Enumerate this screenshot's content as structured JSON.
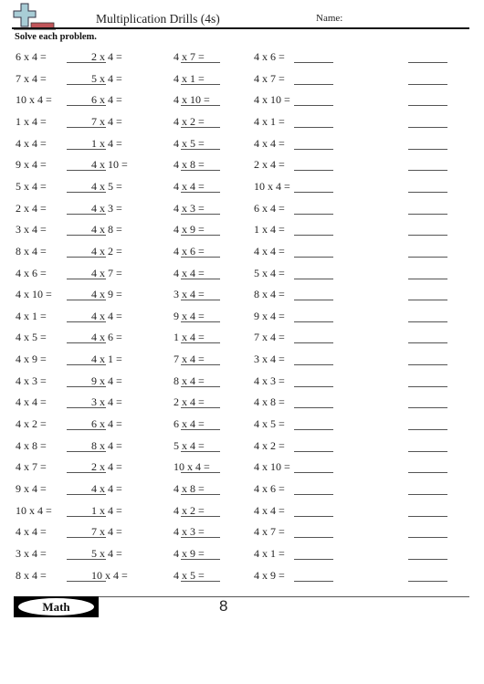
{
  "header": {
    "title": "Multiplication Drills (4s)",
    "name_label": "Name:",
    "instructions": "Solve each problem."
  },
  "logo": {
    "icon": "plus-and-minus-icon",
    "plus_color": "#a8cdd6",
    "minus_color": "#c0555a"
  },
  "problems": {
    "col1": [
      "6 x 4 =",
      "7 x 4 =",
      "10 x 4 =",
      "1 x 4 =",
      "4 x 4 =",
      "9 x 4 =",
      "5 x 4 =",
      "2 x 4 =",
      "3 x 4 =",
      "8 x 4 =",
      "4 x 6 =",
      "4 x 10 =",
      "4 x 1 =",
      "4 x 5 =",
      "4 x 9 =",
      "4 x 3 =",
      "4 x 4 =",
      "4 x 2 =",
      "4 x 8 =",
      "4 x 7 =",
      "9 x 4 =",
      "10 x 4 =",
      "4 x 4 =",
      "3 x 4 =",
      "8 x 4 ="
    ],
    "col2": [
      "2 x 4 =",
      "5 x 4 =",
      "6 x 4 =",
      "7 x 4 =",
      "1 x 4 =",
      "4 x 10 =",
      "4 x 5 =",
      "4 x 3 =",
      "4 x 8 =",
      "4 x 2 =",
      "4 x 7 =",
      "4 x 9 =",
      "4 x 4 =",
      "4 x 6 =",
      "4 x 1 =",
      "9 x 4 =",
      "3 x 4 =",
      "6 x 4 =",
      "8 x 4 =",
      "2 x 4 =",
      "4 x 4 =",
      "1 x 4 =",
      "7 x 4 =",
      "5 x 4 =",
      "10 x 4 ="
    ],
    "col3": [
      "4 x 7 =",
      "4 x 1 =",
      "4 x 10 =",
      "4 x 2 =",
      "4 x 5 =",
      "4 x 8 =",
      "4 x 4 =",
      "4 x 3 =",
      "4 x 9 =",
      "4 x 6 =",
      "4 x 4 =",
      "3 x 4 =",
      "9 x 4 =",
      "1 x 4 =",
      "7 x 4 =",
      "8 x 4 =",
      "2 x 4 =",
      "6 x 4 =",
      "5 x 4 =",
      "10 x 4 =",
      "4 x 8 =",
      "4 x 2 =",
      "4 x 3 =",
      "4 x 9 =",
      "4 x 5 ="
    ],
    "col4": [
      "4 x 6 =",
      "4 x 7 =",
      "4 x 10 =",
      "4 x 1 =",
      "4 x 4 =",
      "2 x 4 =",
      "10 x 4 =",
      "6 x 4 =",
      "1 x 4 =",
      "4 x 4 =",
      "5 x 4 =",
      "8 x 4 =",
      "9 x 4 =",
      "7 x 4 =",
      "3 x 4 =",
      "4 x 3 =",
      "4 x 8 =",
      "4 x 5 =",
      "4 x 2 =",
      "4 x 10 =",
      "4 x 6 =",
      "4 x 4 =",
      "4 x 7 =",
      "4 x 1 =",
      "4 x 9 ="
    ]
  },
  "footer": {
    "badge_label": "Math",
    "page_number": "8"
  }
}
